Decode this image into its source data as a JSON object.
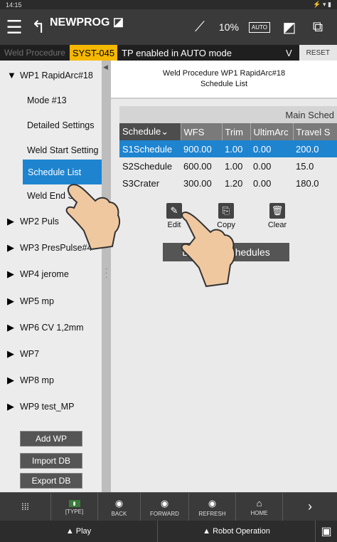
{
  "status": {
    "time": "14:15",
    "right": "⚡ ▾ ▮"
  },
  "topbar": {
    "program": "NEWPROG",
    "speed": "10%",
    "auto": "AUTO"
  },
  "wpbar": {
    "label": "Weld Procedure",
    "code": "SYST-045",
    "message": "TP enabled in AUTO mode",
    "chevron": "V",
    "reset": "RESET"
  },
  "sidebar": {
    "items": [
      {
        "label": "WP1 RapidArc#18",
        "expanded": true
      },
      {
        "label": "Mode #13"
      },
      {
        "label": "Detailed Settings"
      },
      {
        "label": "Weld Start Setting"
      },
      {
        "label": "Schedule List",
        "selected": true
      },
      {
        "label": "Weld End Se"
      },
      {
        "label": "WP2 Puls"
      },
      {
        "label": "WP3 PresPulse#4"
      },
      {
        "label": "WP4 jerome"
      },
      {
        "label": "WP5 mp"
      },
      {
        "label": "WP6 CV 1,2mm"
      },
      {
        "label": "WP7"
      },
      {
        "label": "WP8 mp"
      },
      {
        "label": "WP9 test_MP"
      }
    ],
    "buttons": {
      "add": "Add WP",
      "import": "Import DB",
      "export": "Export DB"
    }
  },
  "main": {
    "title_line1": "Weld Procedure   WP1 RapidArc#18",
    "title_line2": "Schedule List",
    "group_header": "Main Sched",
    "columns": [
      "Schedule",
      "WFS",
      "Trim",
      "UltimArc",
      "Travel S"
    ],
    "rows": [
      {
        "name": "S1Schedule",
        "wfs": "900.00",
        "trim": "1.00",
        "ultimarc": "0.00",
        "travel": "200.0",
        "selected": true
      },
      {
        "name": "S2Schedule",
        "wfs": "600.00",
        "trim": "1.00",
        "ultimarc": "0.00",
        "travel": "15.0"
      },
      {
        "name": "S3Crater",
        "wfs": "300.00",
        "trim": "1.20",
        "ultimarc": "0.00",
        "travel": "180.0"
      }
    ],
    "actions": {
      "edit": "Edit",
      "copy": "Copy",
      "clear": "Clear"
    },
    "schedules_button_left": "D",
    "schedules_button_right": "Schedules"
  },
  "bottombar": {
    "type": "[TYPE]",
    "back": "BACK",
    "forward": "FORWARD",
    "refresh": "REFRESH",
    "home": "HOME"
  },
  "footer": {
    "play": "▲ Play",
    "robot": "▲ Robot Operation"
  },
  "colors": {
    "accent": "#1e84d0",
    "alarm": "#f5b800",
    "bar": "#3a3a3a"
  }
}
